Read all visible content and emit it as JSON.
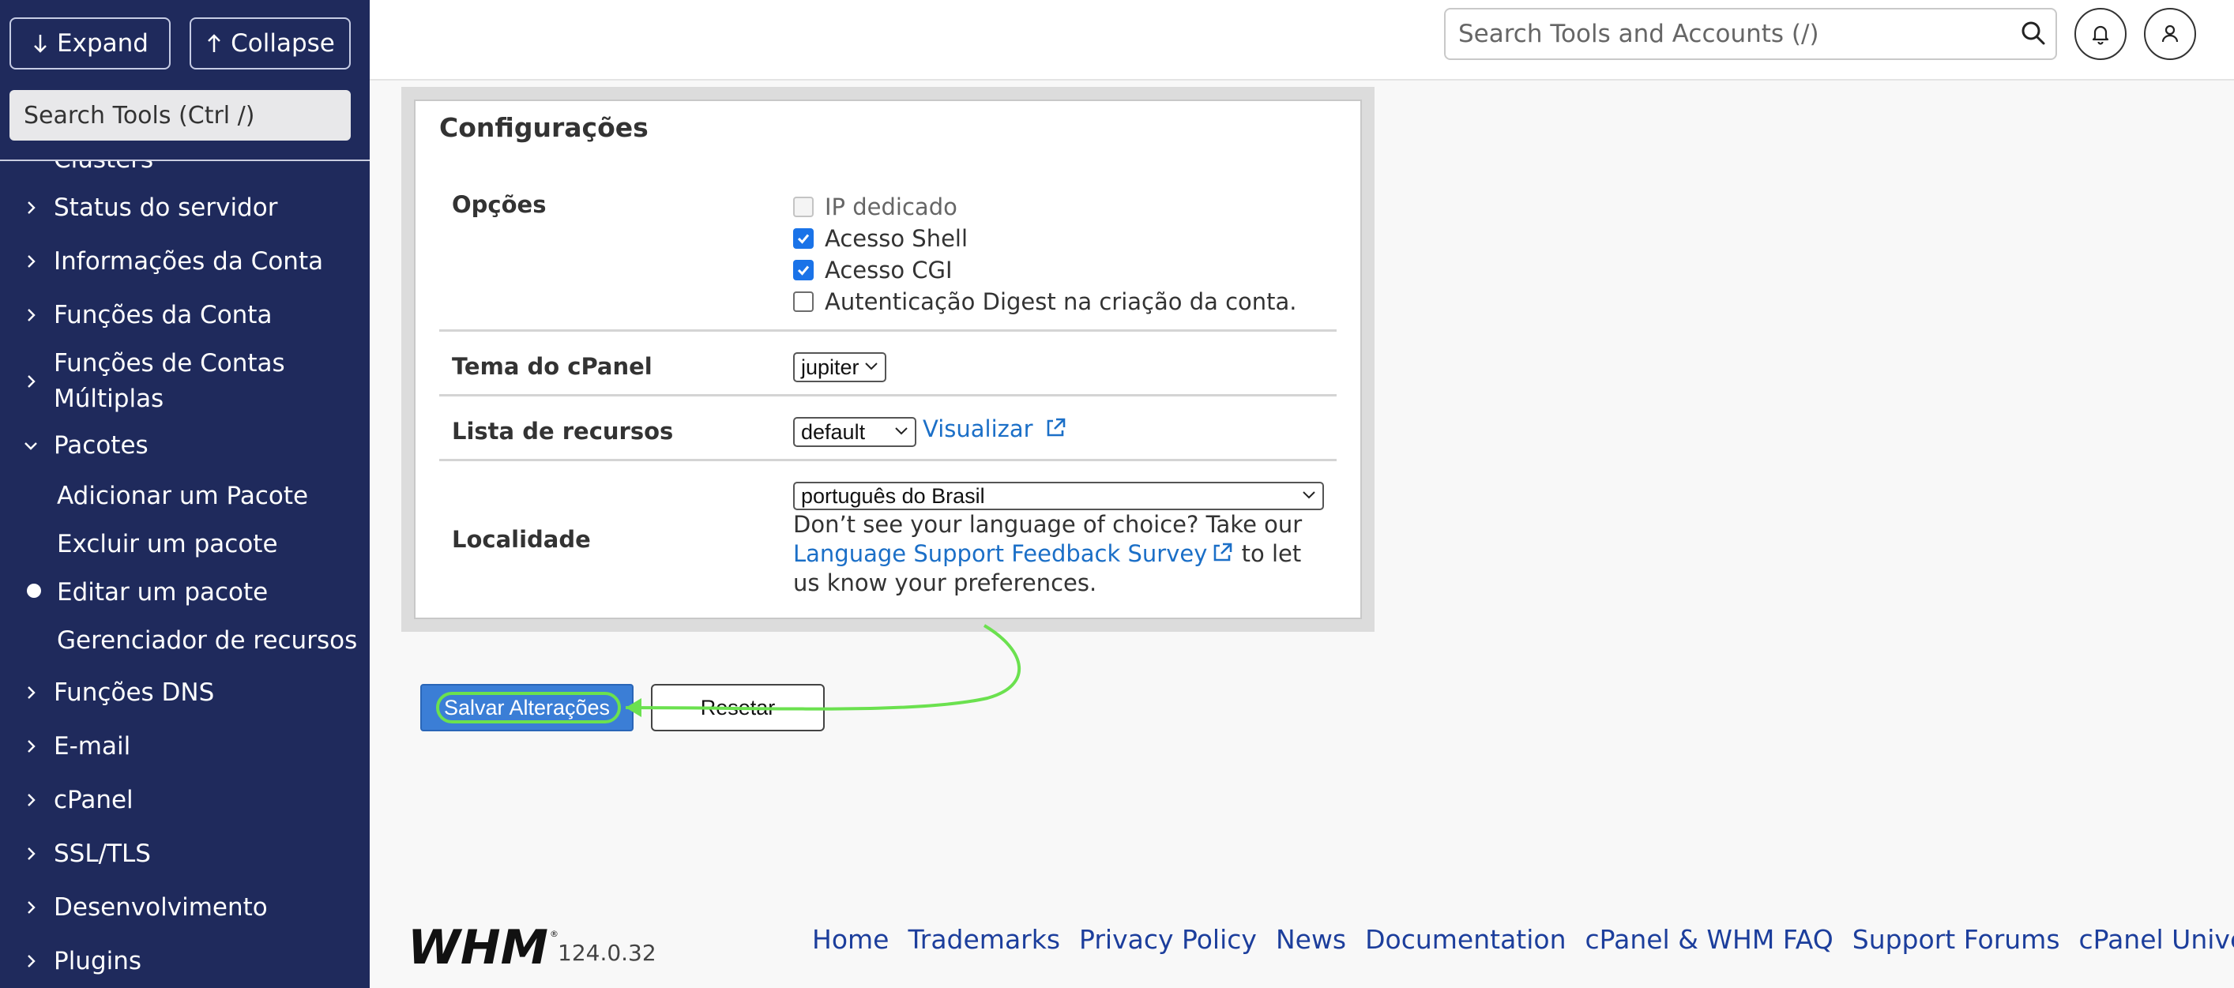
{
  "sidebar": {
    "expand_label": "Expand",
    "collapse_label": "Collapse",
    "search_placeholder": "Search Tools (Ctrl /)",
    "partial_item": "Clusters",
    "items": [
      {
        "label": "Status do servidor"
      },
      {
        "label": "Informações da Conta"
      },
      {
        "label": "Funções da Conta"
      },
      {
        "label": "Funções de Contas Múltiplas"
      },
      {
        "label": "Pacotes"
      },
      {
        "label": "Funções DNS"
      },
      {
        "label": "E-mail"
      },
      {
        "label": "cPanel"
      },
      {
        "label": "SSL/TLS"
      },
      {
        "label": "Desenvolvimento"
      },
      {
        "label": "Plugins"
      }
    ],
    "multi_line_1": "Funções de Contas",
    "multi_line_2": "Múltiplas",
    "sub_items": [
      {
        "label": "Adicionar um Pacote"
      },
      {
        "label": "Excluir um pacote"
      },
      {
        "label": "Editar um pacote",
        "active": true
      },
      {
        "label": "Gerenciador de recursos"
      }
    ]
  },
  "header": {
    "search_placeholder": "Search Tools and Accounts (/)"
  },
  "panel": {
    "title": "Configurações",
    "options_label": "Opções",
    "options": [
      {
        "label": "IP dedicado",
        "checked": false,
        "disabled": true
      },
      {
        "label": "Acesso Shell",
        "checked": true
      },
      {
        "label": "Acesso CGI",
        "checked": true
      },
      {
        "label": "Autenticação Digest na criação da conta.",
        "checked": false
      }
    ],
    "theme_label": "Tema do cPanel",
    "theme_value": "jupiter",
    "features_label": "Lista de recursos",
    "features_value": "default",
    "view_link": "Visualizar",
    "locale_label": "Localidade",
    "locale_value": "português do Brasil",
    "locale_help_1": "Don’t see your language of choice? Take our",
    "locale_help_link": "Language Support Feedback Survey",
    "locale_help_2": "to let us know your preferences."
  },
  "actions": {
    "save_label": "Salvar Alterações",
    "reset_label": "Resetar"
  },
  "footer": {
    "version": "124.0.32",
    "links": [
      "Home",
      "Trademarks",
      "Privacy Policy",
      "News",
      "Documentation",
      "cPanel & WHM FAQ",
      "Support Forums",
      "cPanel University"
    ]
  },
  "colors": {
    "sidebar_bg": "#1f2a5c",
    "link": "#1b6fc7",
    "primary_button": "#3b7ed6",
    "annotation": "#6be14f"
  }
}
